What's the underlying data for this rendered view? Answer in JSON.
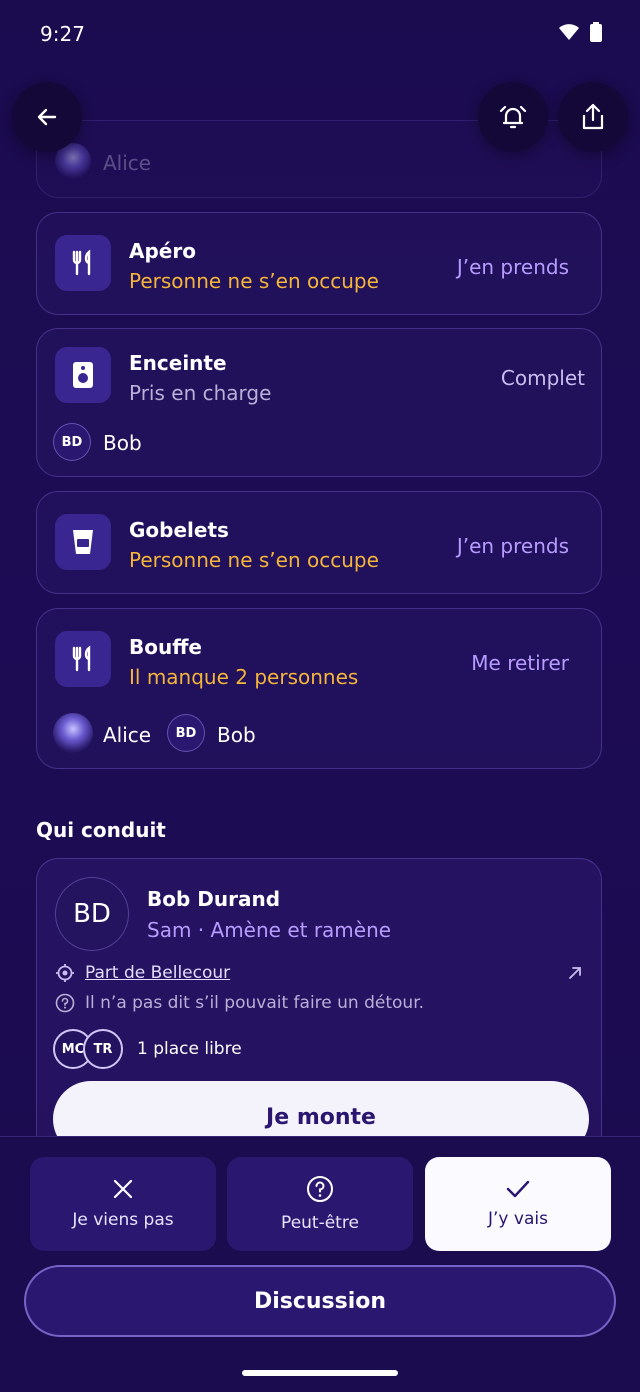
{
  "status": {
    "time": "9:27"
  },
  "top_card": {
    "name": "Alice"
  },
  "items": [
    {
      "title": "Apéro",
      "subtitle": "Personne ne s’en occupe",
      "action": "J’en prends",
      "icon": "fork-knife-icon"
    },
    {
      "title": "Enceinte",
      "subtitle": "Pris en charge",
      "action": "Complet",
      "icon": "speaker-icon",
      "people": [
        {
          "initials": "BD",
          "name": "Bob"
        }
      ]
    },
    {
      "title": "Gobelets",
      "subtitle": "Personne ne s’en occupe",
      "action": "J’en prends",
      "icon": "cup-icon"
    },
    {
      "title": "Bouffe",
      "subtitle": "Il manque 2 personnes",
      "action": "Me retirer",
      "icon": "fork-knife-icon",
      "people": [
        {
          "initials": "",
          "name": "Alice"
        },
        {
          "initials": "BD",
          "name": "Bob"
        }
      ]
    }
  ],
  "drivers": {
    "section_title": "Qui conduit",
    "driver": {
      "initials": "BD",
      "name": "Bob Durand",
      "subtitle": "Sam · Amène et ramène",
      "departure": "Part de Bellecour",
      "detour_note": "Il n’a pas dit s’il pouvait faire un détour.",
      "passengers": [
        "MC",
        "TR"
      ],
      "seats": "1 place libre",
      "board_label": "Je monte"
    }
  },
  "rsvp": {
    "not_coming": "Je viens pas",
    "maybe": "Peut-être",
    "going": "J’y vais"
  },
  "discussion_label": "Discussion",
  "colors": {
    "accent": "#b79cff",
    "warning": "#f5b53a",
    "background": "#1b0b4f"
  }
}
